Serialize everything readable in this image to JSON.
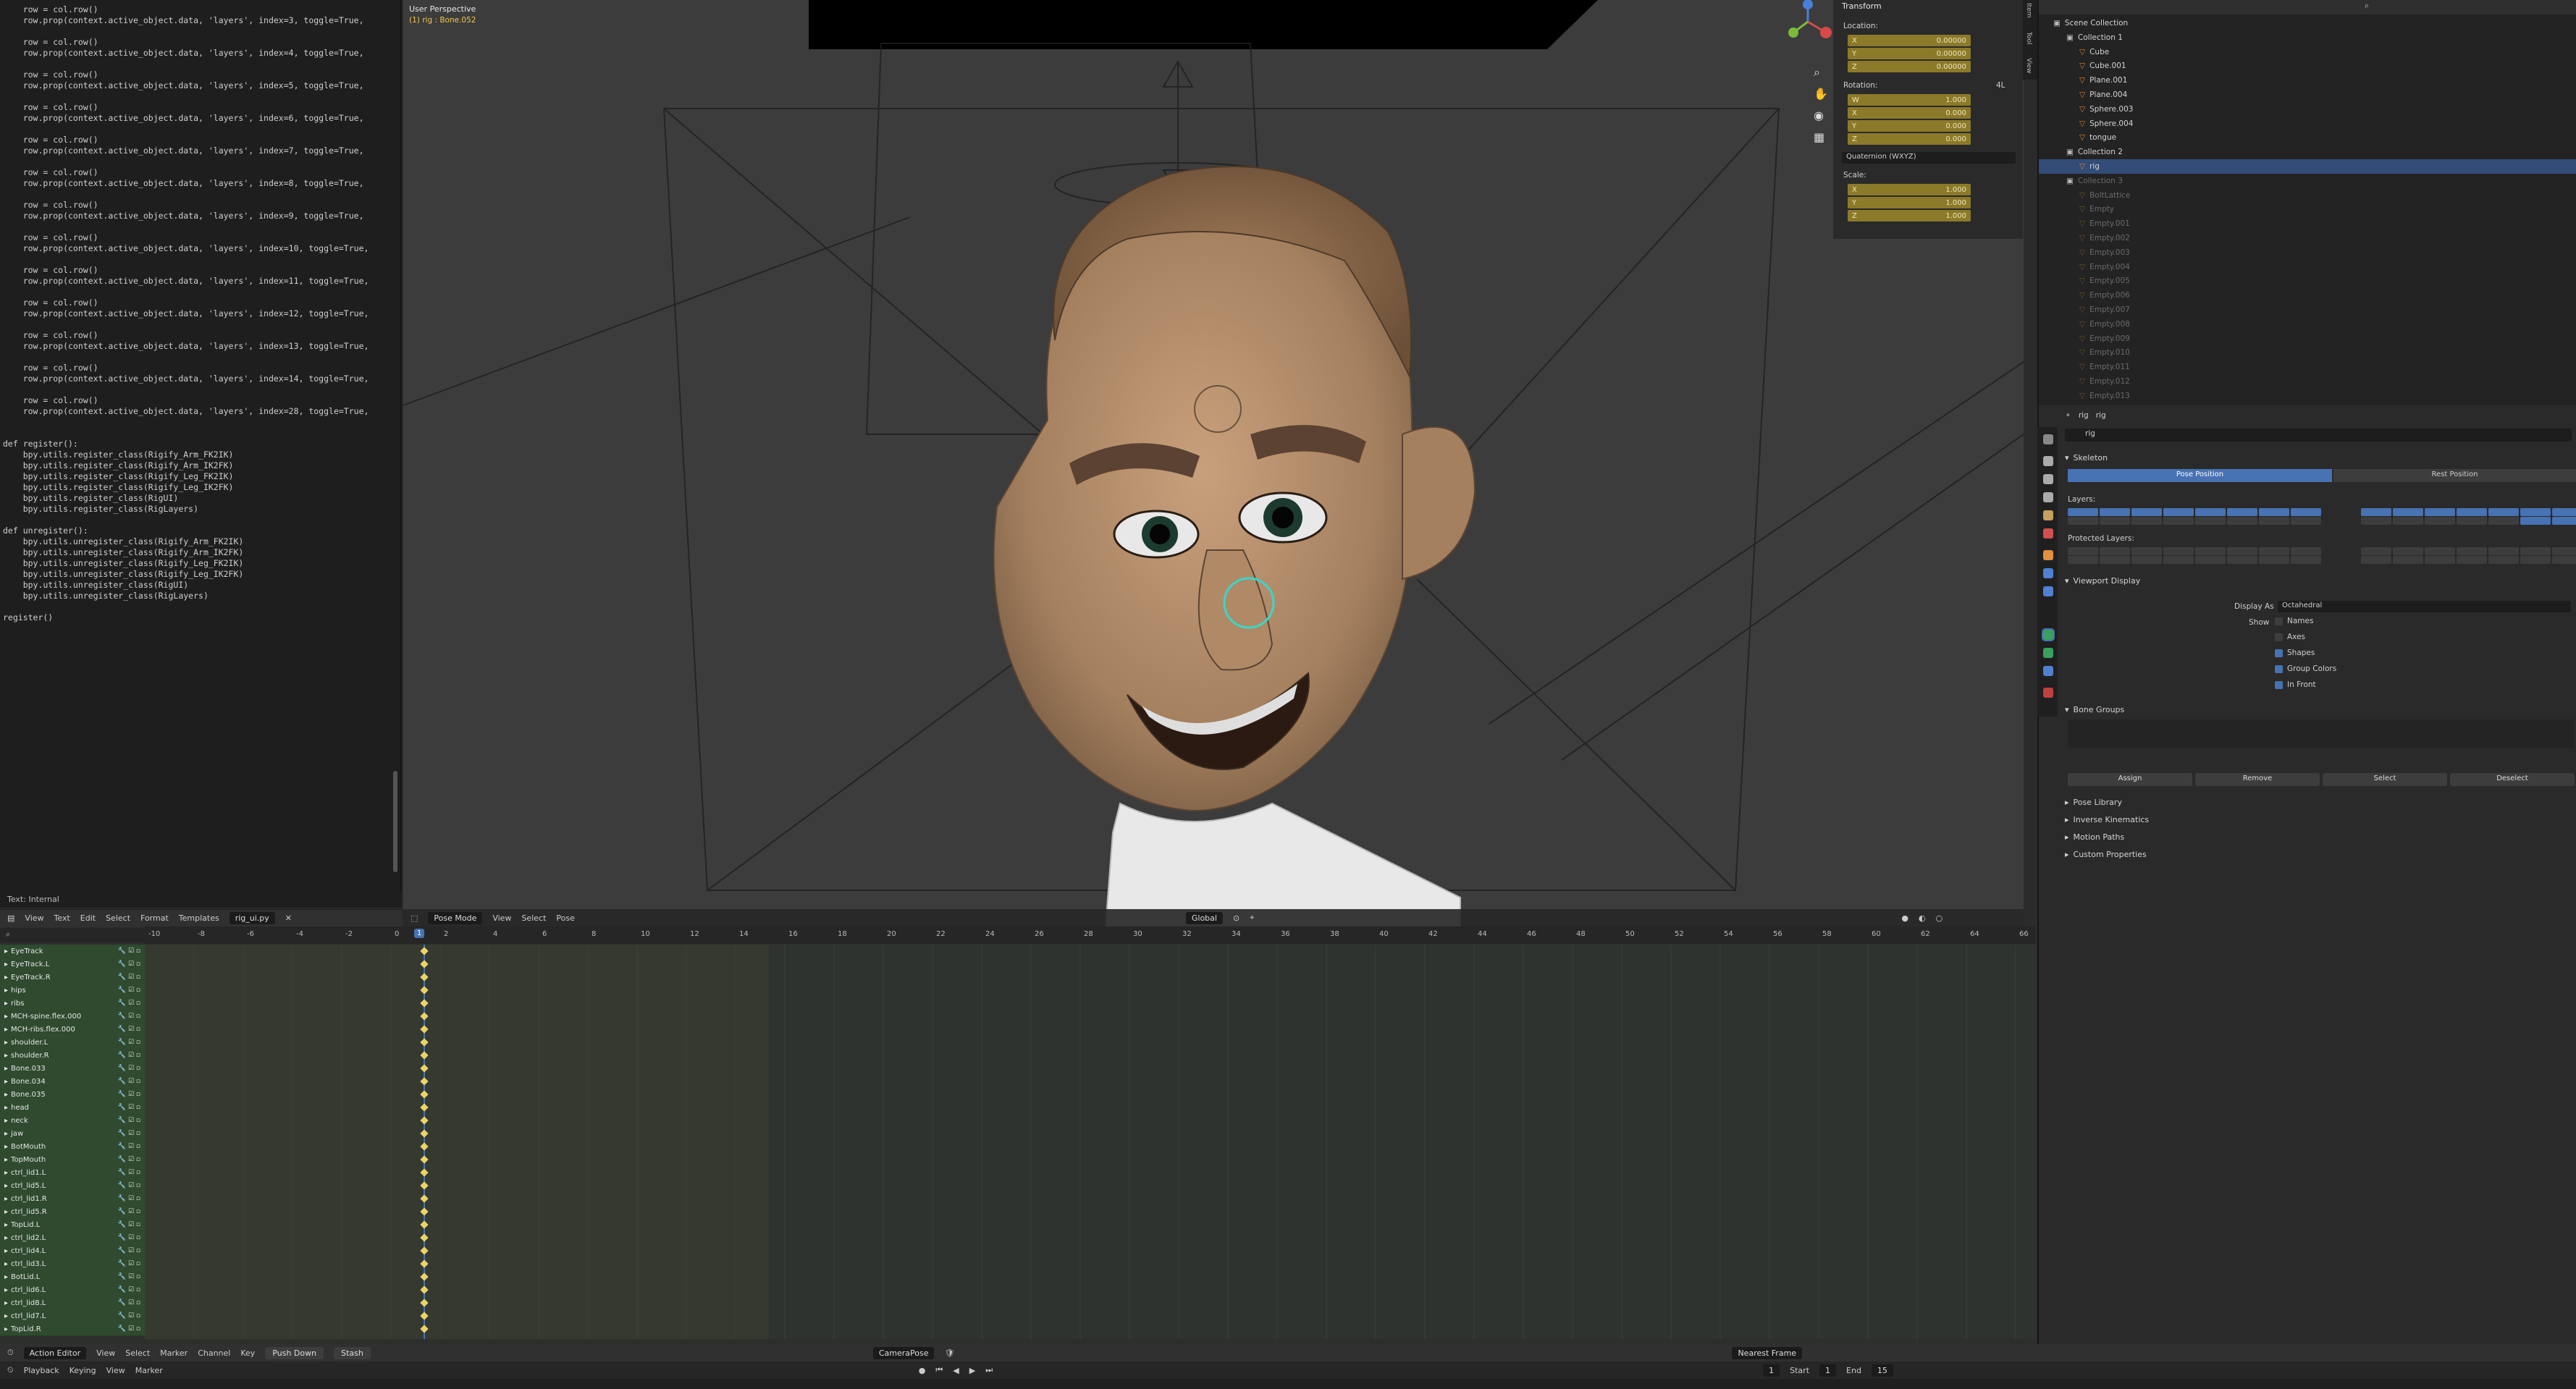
{
  "text_editor": {
    "code": "    row = col.row()\n    row.prop(context.active_object.data, 'layers', index=3, toggle=True,\n\n    row = col.row()\n    row.prop(context.active_object.data, 'layers', index=4, toggle=True,\n\n    row = col.row()\n    row.prop(context.active_object.data, 'layers', index=5, toggle=True,\n\n    row = col.row()\n    row.prop(context.active_object.data, 'layers', index=6, toggle=True,\n\n    row = col.row()\n    row.prop(context.active_object.data, 'layers', index=7, toggle=True,\n\n    row = col.row()\n    row.prop(context.active_object.data, 'layers', index=8, toggle=True,\n\n    row = col.row()\n    row.prop(context.active_object.data, 'layers', index=9, toggle=True,\n\n    row = col.row()\n    row.prop(context.active_object.data, 'layers', index=10, toggle=True,\n\n    row = col.row()\n    row.prop(context.active_object.data, 'layers', index=11, toggle=True,\n\n    row = col.row()\n    row.prop(context.active_object.data, 'layers', index=12, toggle=True,\n\n    row = col.row()\n    row.prop(context.active_object.data, 'layers', index=13, toggle=True,\n\n    row = col.row()\n    row.prop(context.active_object.data, 'layers', index=14, toggle=True,\n\n    row = col.row()\n    row.prop(context.active_object.data, 'layers', index=28, toggle=True,\n\n\ndef register():\n    bpy.utils.register_class(Rigify_Arm_FK2IK)\n    bpy.utils.register_class(Rigify_Arm_IK2FK)\n    bpy.utils.register_class(Rigify_Leg_FK2IK)\n    bpy.utils.register_class(Rigify_Leg_IK2FK)\n    bpy.utils.register_class(RigUI)\n    bpy.utils.register_class(RigLayers)\n\ndef unregister():\n    bpy.utils.unregister_class(Rigify_Arm_FK2IK)\n    bpy.utils.unregister_class(Rigify_Arm_IK2FK)\n    bpy.utils.unregister_class(Rigify_Leg_FK2IK)\n    bpy.utils.unregister_class(Rigify_Leg_IK2FK)\n    bpy.utils.unregister_class(RigUI)\n    bpy.utils.unregister_class(RigLayers)\n\nregister()",
    "status": "Text: Internal",
    "menu": [
      "View",
      "Text",
      "Edit",
      "Select",
      "Format",
      "Templates"
    ],
    "filename": "rig_ui.py"
  },
  "viewport": {
    "perspective": "User Perspective",
    "active": "(1) rig : Bone.052",
    "mode": "Pose Mode",
    "menu": [
      "View",
      "Select",
      "Pose"
    ],
    "orientation": "Global"
  },
  "npanel": {
    "title": "Transform",
    "location_label": "Location:",
    "location": [
      {
        "axis": "X",
        "value": "0.00000"
      },
      {
        "axis": "Y",
        "value": "0.00000"
      },
      {
        "axis": "Z",
        "value": "0.00000"
      }
    ],
    "rotation_label": "Rotation:",
    "rotation_mode": "4L",
    "rotation": [
      {
        "axis": "W",
        "value": "1.000"
      },
      {
        "axis": "X",
        "value": "0.000"
      },
      {
        "axis": "Y",
        "value": "0.000"
      },
      {
        "axis": "Z",
        "value": "0.000"
      }
    ],
    "quaternion": "Quaternion (WXYZ)",
    "scale_label": "Scale:",
    "scale": [
      {
        "axis": "X",
        "value": "1.000"
      },
      {
        "axis": "Y",
        "value": "1.000"
      },
      {
        "axis": "Z",
        "value": "1.000"
      }
    ],
    "tabs": [
      "Item",
      "Tool",
      "View"
    ]
  },
  "outliner": {
    "rows": [
      {
        "label": "Scene Collection",
        "indent": 0,
        "dim": false,
        "sel": false,
        "type": "scene"
      },
      {
        "label": "Collection 1",
        "indent": 1,
        "dim": false,
        "sel": false,
        "type": "coll"
      },
      {
        "label": "Cube",
        "indent": 2,
        "dim": false,
        "sel": false,
        "type": "obj"
      },
      {
        "label": "Cube.001",
        "indent": 2,
        "dim": false,
        "sel": false,
        "type": "obj"
      },
      {
        "label": "Plane.001",
        "indent": 2,
        "dim": false,
        "sel": false,
        "type": "obj"
      },
      {
        "label": "Plane.004",
        "indent": 2,
        "dim": false,
        "sel": false,
        "type": "obj"
      },
      {
        "label": "Sphere.003",
        "indent": 2,
        "dim": false,
        "sel": false,
        "type": "obj"
      },
      {
        "label": "Sphere.004",
        "indent": 2,
        "dim": false,
        "sel": false,
        "type": "obj"
      },
      {
        "label": "tongue",
        "indent": 2,
        "dim": false,
        "sel": false,
        "type": "obj"
      },
      {
        "label": "Collection 2",
        "indent": 1,
        "dim": false,
        "sel": false,
        "type": "coll"
      },
      {
        "label": "rig",
        "indent": 2,
        "dim": false,
        "sel": true,
        "type": "obj"
      },
      {
        "label": "Collection 3",
        "indent": 1,
        "dim": true,
        "sel": false,
        "type": "coll"
      },
      {
        "label": "BoltLattice",
        "indent": 2,
        "dim": true,
        "sel": false,
        "type": "obj"
      },
      {
        "label": "Empty",
        "indent": 2,
        "dim": true,
        "sel": false,
        "type": "obj"
      },
      {
        "label": "Empty.001",
        "indent": 2,
        "dim": true,
        "sel": false,
        "type": "obj"
      },
      {
        "label": "Empty.002",
        "indent": 2,
        "dim": true,
        "sel": false,
        "type": "obj"
      },
      {
        "label": "Empty.003",
        "indent": 2,
        "dim": true,
        "sel": false,
        "type": "obj"
      },
      {
        "label": "Empty.004",
        "indent": 2,
        "dim": true,
        "sel": false,
        "type": "obj"
      },
      {
        "label": "Empty.005",
        "indent": 2,
        "dim": true,
        "sel": false,
        "type": "obj"
      },
      {
        "label": "Empty.006",
        "indent": 2,
        "dim": true,
        "sel": false,
        "type": "obj"
      },
      {
        "label": "Empty.007",
        "indent": 2,
        "dim": true,
        "sel": false,
        "type": "obj"
      },
      {
        "label": "Empty.008",
        "indent": 2,
        "dim": true,
        "sel": false,
        "type": "obj"
      },
      {
        "label": "Empty.009",
        "indent": 2,
        "dim": true,
        "sel": false,
        "type": "obj"
      },
      {
        "label": "Empty.010",
        "indent": 2,
        "dim": true,
        "sel": false,
        "type": "obj"
      },
      {
        "label": "Empty.011",
        "indent": 2,
        "dim": true,
        "sel": false,
        "type": "obj"
      },
      {
        "label": "Empty.012",
        "indent": 2,
        "dim": true,
        "sel": false,
        "type": "obj"
      },
      {
        "label": "Empty.013",
        "indent": 2,
        "dim": true,
        "sel": false,
        "type": "obj"
      }
    ]
  },
  "properties": {
    "breadcrumb": [
      "rig",
      "rig"
    ],
    "data_name": "rig",
    "skeleton": "Skeleton",
    "pose_position": "Pose Position",
    "rest_position": "Rest Position",
    "layers_label": "Layers:",
    "protected_label": "Protected Layers:",
    "viewport_display": "Viewport Display",
    "display_as_label": "Display As",
    "display_as": "Octahedral",
    "show_label": "Show",
    "show_options": [
      {
        "label": "Names",
        "checked": false
      },
      {
        "label": "Axes",
        "checked": false
      },
      {
        "label": "Shapes",
        "checked": true
      },
      {
        "label": "Group Colors",
        "checked": true
      },
      {
        "label": "In Front",
        "checked": true
      }
    ],
    "bone_groups": "Bone Groups",
    "group_buttons": [
      "Assign",
      "Remove",
      "Select",
      "Deselect"
    ],
    "sections": [
      "Pose Library",
      "Inverse Kinematics",
      "Motion Paths",
      "Custom Properties"
    ]
  },
  "dopesheet": {
    "ruler": [
      "-10",
      "-8",
      "-6",
      "-4",
      "-2",
      "0",
      "2",
      "4",
      "6",
      "8",
      "10",
      "12",
      "14",
      "16",
      "18",
      "20",
      "22",
      "24",
      "26",
      "28",
      "30",
      "32",
      "34",
      "36",
      "38",
      "40",
      "42",
      "44",
      "46",
      "48",
      "50",
      "52",
      "54",
      "56",
      "58",
      "60",
      "62",
      "64",
      "66"
    ],
    "current_frame": "1",
    "channels": [
      "EyeTrack",
      "EyeTrack.L",
      "EyeTrack.R",
      "hips",
      "ribs",
      "MCH-spine.flex.000",
      "MCH-ribs.flex.000",
      "shoulder.L",
      "shoulder.R",
      "Bone.033",
      "Bone.034",
      "Bone.035",
      "head",
      "neck",
      "jaw",
      "BotMouth",
      "TopMouth",
      "ctrl_lid1.L",
      "ctrl_lid5.L",
      "ctrl_lid1.R",
      "ctrl_lid5.R",
      "TopLid.L",
      "ctrl_lid2.L",
      "ctrl_lid4.L",
      "ctrl_lid3.L",
      "BotLid.L",
      "ctrl_lid6.L",
      "ctrl_lid8.L",
      "ctrl_lid7.L",
      "TopLid.R"
    ],
    "editor_mode": "Action Editor",
    "menu": [
      "View",
      "Select",
      "Marker",
      "Channel",
      "Key"
    ],
    "push_down": "Push Down",
    "stash": "Stash",
    "action": "CameraPose",
    "snap": "Nearest Frame"
  },
  "playback": {
    "menu": [
      "Playback",
      "Keying",
      "View",
      "Marker"
    ],
    "frame": "1",
    "start_label": "Start",
    "start": "1",
    "end_label": "End",
    "end": "15"
  },
  "colors": {
    "accent": "#4772b3",
    "yellow": "#8b7a2a",
    "key": "#e8d46a",
    "channel": "#2f4a2f"
  }
}
